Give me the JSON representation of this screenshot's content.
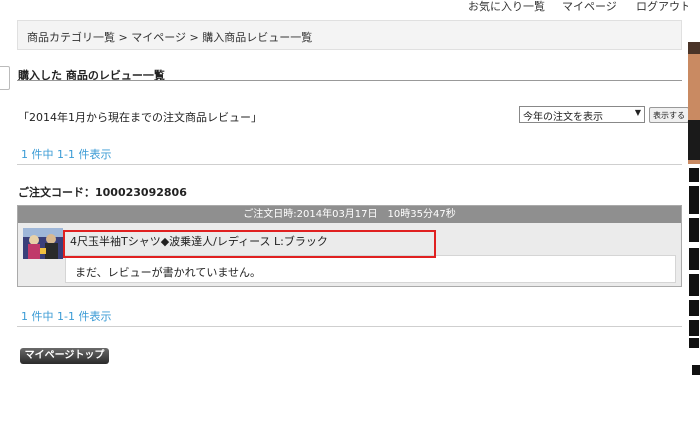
{
  "topnav": {
    "favorites": "お気に入り一覧",
    "mypage": "マイページ",
    "logout": "ログアウト"
  },
  "breadcrumb": "商品カテゴリ一覧 > マイページ > 購入商品レビュー一覧",
  "page_title": "購入した 商品のレビュー一覧",
  "period_label": "「2014年1月から現在までの注文商品レビュー」",
  "period_select": {
    "value": "今年の注文を表示"
  },
  "show_button": "表示する",
  "pager_top": "1 件中 1-1 件表示",
  "pager_bottom": "1 件中 1-1 件表示",
  "order": {
    "code_label": "ご注文コード：",
    "code": "100023092806",
    "datetime": "ご注文日時:2014年03月17日　10時35分47秒",
    "product_name": "4尺玉半袖Tシャツ◆波乗達人/レディース L:ブラック",
    "review_text": "まだ、レビューが書かれていません。"
  },
  "mypage_top_button": "マイページトップ",
  "colors": {
    "pager_link": "#3a9bd5",
    "highlight": "#e02020",
    "order_header": "#8f8f8f"
  }
}
